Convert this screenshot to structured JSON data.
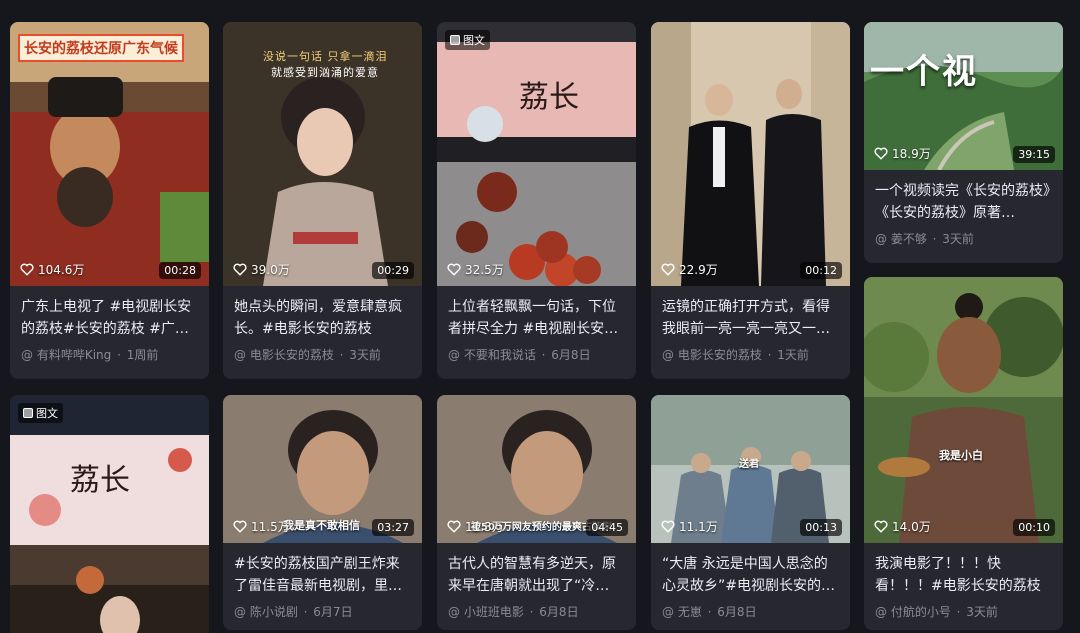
{
  "cards": [
    {
      "type": "",
      "likes": "104.6万",
      "duration": "00:28",
      "title": "广东上电视了 #电视剧长安的荔枝#长安的荔枝 #广东…",
      "author": "有料哔哔King",
      "time": "1周前",
      "overlay_text": "长安的荔枝还原广东气候"
    },
    {
      "type": "",
      "likes": "39.0万",
      "duration": "00:29",
      "title": "她点头的瞬间，爱意肆意疯长。#电影长安的荔枝",
      "author": "电影长安的荔枝",
      "time": "3天前",
      "overlay_text": "没说一句话 只拿一滴泪",
      "overlay_text2": "就感受到汹涌的爱意"
    },
    {
      "type": "图文",
      "likes": "32.5万",
      "duration": "",
      "title": "上位者轻飘飘一句话，下位者拼尽全力 #电视剧长安…",
      "author": "不要和我说话",
      "time": "6月8日"
    },
    {
      "type": "",
      "likes": "22.9万",
      "duration": "00:12",
      "title": "运镜的正确打开方式，看得我眼前一亮一亮一亮又一…",
      "author": "电影长安的荔枝",
      "time": "1天前"
    },
    {
      "type": "",
      "likes": "18.9万",
      "duration": "39:15",
      "title": "一个视频读完《长安的荔枝》《长安的荔枝》原著…",
      "author": "姜不够",
      "time": "3天前",
      "overlay_text": "一个视"
    },
    {
      "type": "图文",
      "likes": "",
      "duration": "",
      "title": "",
      "author": "",
      "time": ""
    },
    {
      "type": "",
      "likes": "11.5万",
      "duration": "03:27",
      "title": "#长安的荔枝国产剧王炸来了雷佳音最新电视剧，里面…",
      "author": "陈小说剧",
      "time": "6月7日",
      "overlay_text": "我是真不敢相信"
    },
    {
      "type": "",
      "likes": "11.3万",
      "duration": "04:45",
      "title": "古代人的智慧有多逆天，原来早在唐朝就出现了“冷…",
      "author": "小班班电影",
      "time": "6月8日",
      "overlay_text": "被500万网友预约的最爽古装剧"
    },
    {
      "type": "",
      "likes": "11.1万",
      "duration": "00:13",
      "title": "“大唐 永远是中国人思念的心灵故乡”#电视剧长安的…",
      "author": "无崽",
      "time": "6月8日",
      "overlay_text": "送君"
    },
    {
      "type": "",
      "likes": "14.0万",
      "duration": "00:10",
      "title": "我演电影了！！！快看！！！#电影长安的荔枝",
      "author": "付航的小号",
      "time": "3天前",
      "overlay_text": "我是小白"
    }
  ],
  "colors": {
    "background": "#16171d",
    "card": "#26272f",
    "meta": "#8a8b94"
  }
}
